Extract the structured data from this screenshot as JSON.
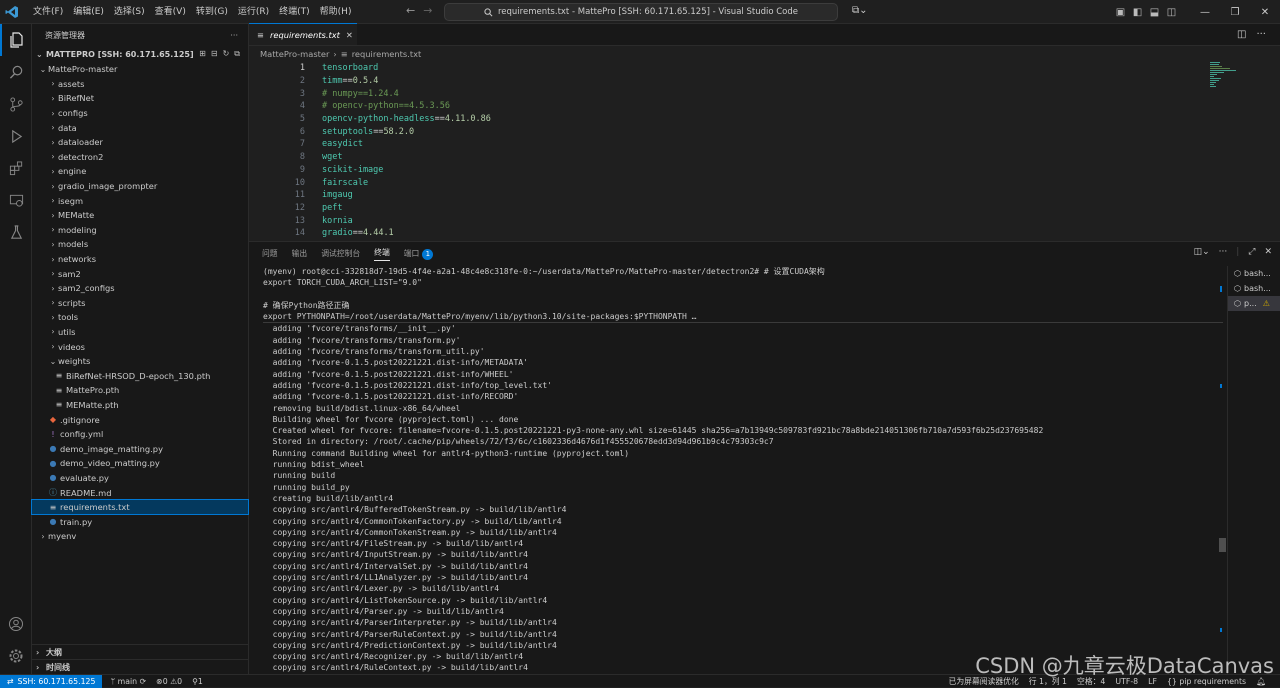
{
  "titlebar": {
    "menus": [
      "文件(F)",
      "编辑(E)",
      "选择(S)",
      "查看(V)",
      "转到(G)",
      "运行(R)",
      "终端(T)",
      "帮助(H)"
    ],
    "search_text": "requirements.txt - MattePro [SSH: 60.171.65.125] - Visual Studio Code"
  },
  "sidebar": {
    "title": "资源管理器",
    "root": "MATTEPRO [SSH: 60.171.65.125]",
    "items": [
      {
        "label": "MattePro-master",
        "type": "folder-open",
        "depth": 1
      },
      {
        "label": "assets",
        "type": "folder",
        "depth": 2
      },
      {
        "label": "BiRefNet",
        "type": "folder",
        "depth": 2
      },
      {
        "label": "configs",
        "type": "folder",
        "depth": 2
      },
      {
        "label": "data",
        "type": "folder",
        "depth": 2
      },
      {
        "label": "dataloader",
        "type": "folder",
        "depth": 2
      },
      {
        "label": "detectron2",
        "type": "folder",
        "depth": 2
      },
      {
        "label": "engine",
        "type": "folder",
        "depth": 2
      },
      {
        "label": "gradio_image_prompter",
        "type": "folder",
        "depth": 2
      },
      {
        "label": "isegm",
        "type": "folder",
        "depth": 2
      },
      {
        "label": "MEMatte",
        "type": "folder",
        "depth": 2
      },
      {
        "label": "modeling",
        "type": "folder",
        "depth": 2
      },
      {
        "label": "models",
        "type": "folder",
        "depth": 2
      },
      {
        "label": "networks",
        "type": "folder",
        "depth": 2
      },
      {
        "label": "sam2",
        "type": "folder",
        "depth": 2
      },
      {
        "label": "sam2_configs",
        "type": "folder",
        "depth": 2
      },
      {
        "label": "scripts",
        "type": "folder",
        "depth": 2
      },
      {
        "label": "tools",
        "type": "folder",
        "depth": 2
      },
      {
        "label": "utils",
        "type": "folder",
        "depth": 2
      },
      {
        "label": "videos",
        "type": "folder",
        "depth": 2
      },
      {
        "label": "weights",
        "type": "folder-open",
        "depth": 2
      },
      {
        "label": "BiRefNet-HRSOD_D-epoch_130.pth",
        "type": "file",
        "depth": 3
      },
      {
        "label": "MattePro.pth",
        "type": "file",
        "depth": 3
      },
      {
        "label": "MEMatte.pth",
        "type": "file",
        "depth": 3
      },
      {
        "label": ".gitignore",
        "type": "git",
        "depth": 2
      },
      {
        "label": "config.yml",
        "type": "yml",
        "depth": 2
      },
      {
        "label": "demo_image_matting.py",
        "type": "py",
        "depth": 2
      },
      {
        "label": "demo_video_matting.py",
        "type": "py",
        "depth": 2
      },
      {
        "label": "evaluate.py",
        "type": "py",
        "depth": 2
      },
      {
        "label": "README.md",
        "type": "md",
        "depth": 2
      },
      {
        "label": "requirements.txt",
        "type": "txt",
        "depth": 2,
        "selected": true
      },
      {
        "label": "train.py",
        "type": "py",
        "depth": 2
      },
      {
        "label": "myenv",
        "type": "folder",
        "depth": 1
      }
    ],
    "outline": "大纲",
    "timeline": "时间线"
  },
  "editor": {
    "tab_label": "requirements.txt",
    "breadcrumb": [
      "MattePro-master",
      "requirements.txt"
    ],
    "lines": [
      {
        "n": "1",
        "text": "tensorboard",
        "kind": "pkg"
      },
      {
        "n": "2",
        "text": "timm==0.5.4",
        "kind": "pkg"
      },
      {
        "n": "3",
        "text": "# numpy==1.24.4",
        "kind": "comment"
      },
      {
        "n": "4",
        "text": "# opencv-python==4.5.3.56",
        "kind": "comment"
      },
      {
        "n": "5",
        "text": "opencv-python-headless==4.11.0.86",
        "kind": "pkg"
      },
      {
        "n": "6",
        "text": "setuptools==58.2.0",
        "kind": "pkg"
      },
      {
        "n": "7",
        "text": "easydict",
        "kind": "pkg"
      },
      {
        "n": "8",
        "text": "wget",
        "kind": "pkg"
      },
      {
        "n": "9",
        "text": "scikit-image",
        "kind": "pkg"
      },
      {
        "n": "10",
        "text": "fairscale",
        "kind": "pkg"
      },
      {
        "n": "11",
        "text": "imgaug",
        "kind": "pkg"
      },
      {
        "n": "12",
        "text": "peft",
        "kind": "pkg"
      },
      {
        "n": "13",
        "text": "kornia",
        "kind": "pkg"
      },
      {
        "n": "14",
        "text": "gradio==4.44.1",
        "kind": "pkg"
      }
    ]
  },
  "panel": {
    "tabs": [
      "问题",
      "输出",
      "调试控制台",
      "终端",
      "端口"
    ],
    "active_tab": "终端",
    "ports_badge": "1",
    "sticky": [
      "(myenv) root@cci-332818d7-19d5-4f4e-a2a1-48c4e8c318fe-0:~/userdata/MattePro/MattePro-master/detectron2# # 设置CUDA架构",
      "export TORCH_CUDA_ARCH_LIST=\"9.0\"",
      "",
      "# 确保Python路径正确",
      "export PYTHONPATH=/root/userdata/MattePro/myenv/lib/python3.10/site-packages:$PYTHONPATH …"
    ],
    "output": [
      "  adding 'fvcore/transforms/__init__.py'",
      "  adding 'fvcore/transforms/transform.py'",
      "  adding 'fvcore/transforms/transform_util.py'",
      "  adding 'fvcore-0.1.5.post20221221.dist-info/METADATA'",
      "  adding 'fvcore-0.1.5.post20221221.dist-info/WHEEL'",
      "  adding 'fvcore-0.1.5.post20221221.dist-info/top_level.txt'",
      "  adding 'fvcore-0.1.5.post20221221.dist-info/RECORD'",
      "  removing build/bdist.linux-x86_64/wheel",
      "  Building wheel for fvcore (pyproject.toml) ... done",
      "  Created wheel for fvcore: filename=fvcore-0.1.5.post20221221-py3-none-any.whl size=61445 sha256=a7b13949c509783fd921bc78a8bde214051306fb710a7d593f6b25d237695482",
      "  Stored in directory: /root/.cache/pip/wheels/72/f3/6c/c1602336d4676d1f455520678edd3d94d961b9c4c79303c9c7",
      "  Running command Building wheel for antlr4-python3-runtime (pyproject.toml)",
      "  running bdist_wheel",
      "  running build",
      "  running build_py",
      "  creating build/lib/antlr4",
      "  copying src/antlr4/BufferedTokenStream.py -> build/lib/antlr4",
      "  copying src/antlr4/CommonTokenFactory.py -> build/lib/antlr4",
      "  copying src/antlr4/CommonTokenStream.py -> build/lib/antlr4",
      "  copying src/antlr4/FileStream.py -> build/lib/antlr4",
      "  copying src/antlr4/InputStream.py -> build/lib/antlr4",
      "  copying src/antlr4/IntervalSet.py -> build/lib/antlr4",
      "  copying src/antlr4/LL1Analyzer.py -> build/lib/antlr4",
      "  copying src/antlr4/Lexer.py -> build/lib/antlr4",
      "  copying src/antlr4/ListTokenSource.py -> build/lib/antlr4",
      "  copying src/antlr4/Parser.py -> build/lib/antlr4",
      "  copying src/antlr4/ParserInterpreter.py -> build/lib/antlr4",
      "  copying src/antlr4/ParserRuleContext.py -> build/lib/antlr4",
      "  copying src/antlr4/PredictionContext.py -> build/lib/antlr4",
      "  copying src/antlr4/Recognizer.py -> build/lib/antlr4",
      "  copying src/antlr4/RuleContext.py -> build/lib/antlr4"
    ],
    "terminals": [
      {
        "label": "bash...",
        "icon": "terminal-icon"
      },
      {
        "label": "bash...",
        "icon": "terminal-icon"
      },
      {
        "label": "p...",
        "icon": "terminal-icon",
        "warning": true,
        "active": true
      }
    ]
  },
  "status": {
    "remote": "SSH: 60.171.65.125",
    "branch": "main",
    "errors": "0",
    "warnings": "0",
    "ports": "1",
    "screen_reader": "已为屏幕阅读器优化",
    "position": "行 1，列 1",
    "spaces": "空格：4",
    "encoding": "UTF-8",
    "eol": "LF",
    "language": "pip requirements"
  },
  "watermark": "CSDN @九章云极DataCanvas",
  "colors": {
    "accent": "#0078d4",
    "keyword": "#4ec9b0",
    "number": "#b5cea8",
    "comment": "#6a9955"
  }
}
